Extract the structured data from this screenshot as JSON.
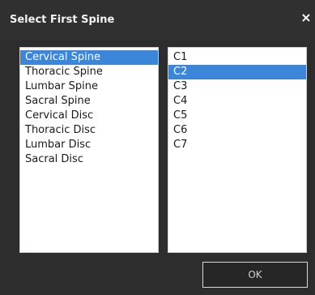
{
  "window": {
    "title": "Select First Spine",
    "close_glyph": "×"
  },
  "left_list": {
    "items": [
      {
        "label": "Cervical Spine",
        "selected": true
      },
      {
        "label": "Thoracic Spine"
      },
      {
        "label": "Lumbar Spine"
      },
      {
        "label": "Sacral Spine"
      },
      {
        "label": "Cervical Disc"
      },
      {
        "label": "Thoracic Disc"
      },
      {
        "label": "Lumbar Disc"
      },
      {
        "label": "Sacral Disc"
      }
    ]
  },
  "right_list": {
    "items": [
      {
        "label": "C1"
      },
      {
        "label": "C2",
        "selected": true
      },
      {
        "label": "C3"
      },
      {
        "label": "C4"
      },
      {
        "label": "C5"
      },
      {
        "label": "C6"
      },
      {
        "label": "C7"
      }
    ]
  },
  "buttons": {
    "ok_label": "OK"
  },
  "colors": {
    "selection": "#3c86d9",
    "dialog_bg": "#2d2d2d"
  }
}
